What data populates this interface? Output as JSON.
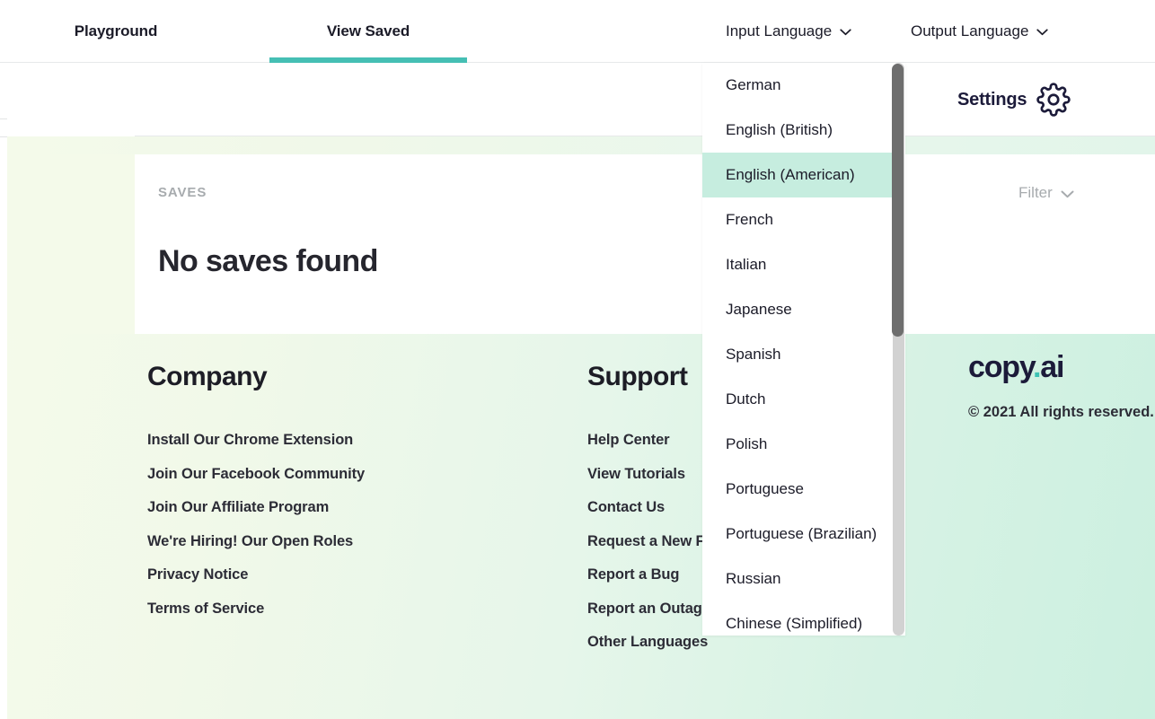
{
  "topbar": {
    "tabs": [
      {
        "label": "Playground",
        "active": false
      },
      {
        "label": "View Saved",
        "active": true
      }
    ],
    "input_language": {
      "label": "Input Language",
      "icon": "chevron-down-icon"
    },
    "output_language": {
      "label": "Output Language",
      "icon": "chevron-down-icon"
    }
  },
  "header": {
    "settings_label": "Settings",
    "settings_icon": "gear-icon"
  },
  "saves_panel": {
    "section_label": "SAVES",
    "empty_message": "No saves found",
    "filter_label": "Filter",
    "filter_icon": "chevron-down-icon"
  },
  "dropdown": {
    "name": "input-language-dropdown",
    "selected": "English (American)",
    "options": [
      "German",
      "English (British)",
      "English (American)",
      "French",
      "Italian",
      "Japanese",
      "Spanish",
      "Dutch",
      "Polish",
      "Portuguese",
      "Portuguese (Brazilian)",
      "Russian",
      "Chinese (Simplified)"
    ]
  },
  "footer": {
    "columns": [
      {
        "heading": "Company",
        "links": [
          "Install Our Chrome Extension",
          "Join Our Facebook Community",
          "Join Our Affiliate Program",
          "We're Hiring! Our Open Roles",
          "Privacy Notice",
          "Terms of Service"
        ]
      },
      {
        "heading": "Support",
        "links": [
          "Help Center",
          "View Tutorials",
          "Contact Us",
          "Request a New Feature",
          "Report a Bug",
          "Report an Outage",
          "Other Languages"
        ]
      }
    ],
    "brand": {
      "name_main": "copy",
      "name_dot": ".",
      "name_suffix": "ai",
      "copyright": "© 2021 All rights reserved."
    }
  },
  "colors": {
    "accent_teal": "#45bfb4",
    "brand_navy": "#1c1b3a",
    "highlight_mint": "#c6eddf",
    "muted_gray": "#a7abae"
  }
}
